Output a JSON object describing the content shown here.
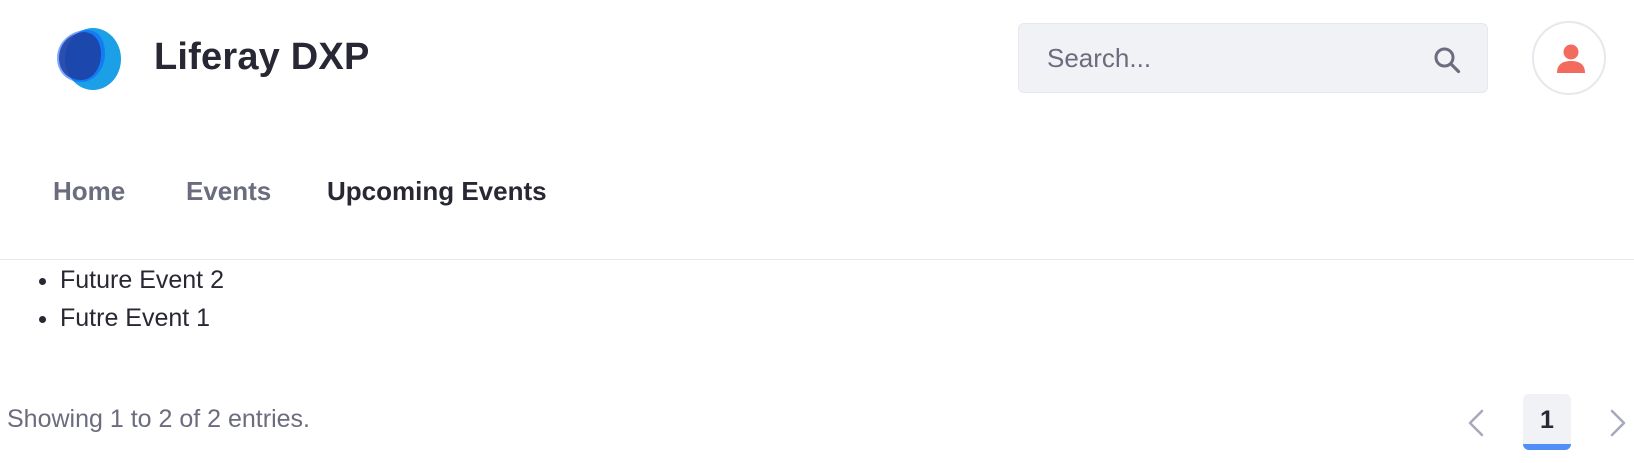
{
  "header": {
    "site_title": "Liferay DXP",
    "logo_icon": "liferay-logo-icon",
    "search": {
      "placeholder": "Search...",
      "value": "",
      "icon": "search-icon"
    },
    "user_icon": "user-icon"
  },
  "nav": {
    "items": [
      {
        "label": "Home",
        "active": false
      },
      {
        "label": "Events",
        "active": false
      },
      {
        "label": "Upcoming Events",
        "active": true
      }
    ]
  },
  "main": {
    "events": [
      {
        "title": "Future Event 2"
      },
      {
        "title": "Futre Event 1"
      }
    ]
  },
  "pagination": {
    "results_text": "Showing 1 to 2 of 2 entries.",
    "current_page": "1",
    "prev_icon": "chevron-left-icon",
    "next_icon": "chevron-right-icon"
  },
  "colors": {
    "logo_light": "#1ba0e8",
    "logo_dark": "#0b5fff",
    "logo_overlap": "#1e3ea0",
    "title_text": "#272833",
    "muted_text": "#6b6c7e",
    "search_bg": "#f1f2f5",
    "user_icon": "#f36a5f",
    "active_page_bar": "#528ef7"
  }
}
